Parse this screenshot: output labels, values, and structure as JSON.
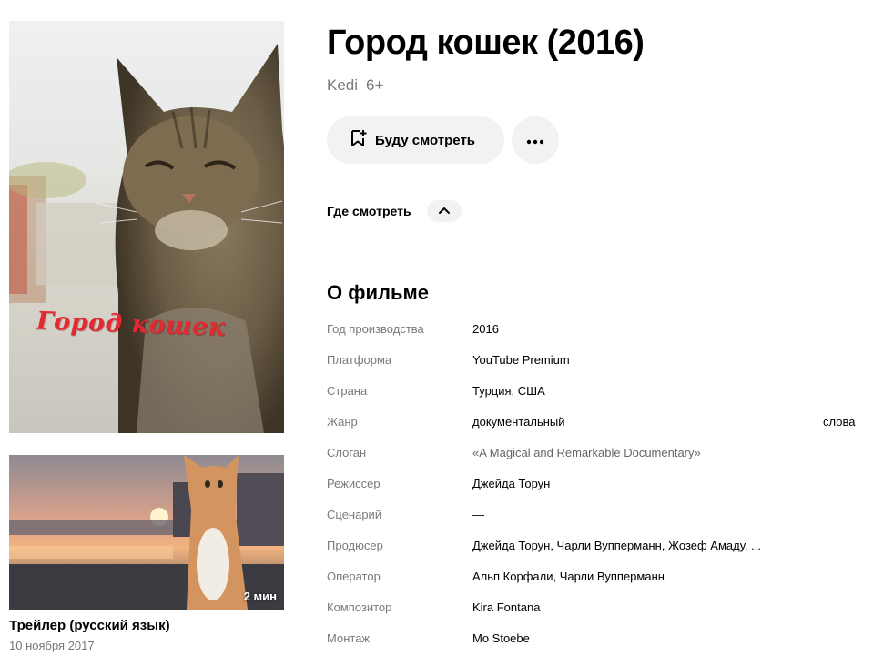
{
  "poster": {
    "overlay_text": "Город кошек"
  },
  "trailer": {
    "duration": "2 мин",
    "title": "Трейлер (русский язык)",
    "date": "10 ноября 2017"
  },
  "movie": {
    "title": "Город кошек (2016)",
    "original_title": "Kedi",
    "age_rating": "6+"
  },
  "actions": {
    "watchlist_label": "Буду смотреть",
    "more_icon": "more-dots-icon",
    "watchlist_icon": "bookmark-plus-icon"
  },
  "where_to_watch": {
    "label": "Где смотреть",
    "toggle_icon": "chevron-up-icon"
  },
  "about": {
    "heading": "О фильме",
    "rows": [
      {
        "label": "Год производства",
        "value": "2016"
      },
      {
        "label": "Платформа",
        "value": "YouTube Premium"
      },
      {
        "label": "Страна",
        "value": "Турция, США"
      },
      {
        "label": "Жанр",
        "value": "документальный",
        "extra": "слова"
      },
      {
        "label": "Слоган",
        "value": "«A Magical and Remarkable Documentary»"
      },
      {
        "label": "Режиссер",
        "value": "Джейда Торун"
      },
      {
        "label": "Сценарий",
        "value": "—"
      },
      {
        "label": "Продюсер",
        "value": "Джейда Торун, Чарли Вупперманн, Жозеф Амаду, ..."
      },
      {
        "label": "Оператор",
        "value": "Альп Корфали, Чарли Вупперманн"
      },
      {
        "label": "Композитор",
        "value": "Kira Fontana"
      },
      {
        "label": "Монтаж",
        "value": "Mo Stoebe"
      }
    ]
  },
  "colors": {
    "poster_title": "#e32a33",
    "button_bg": "#f2f2f2",
    "muted_text": "#7a7a7a"
  }
}
